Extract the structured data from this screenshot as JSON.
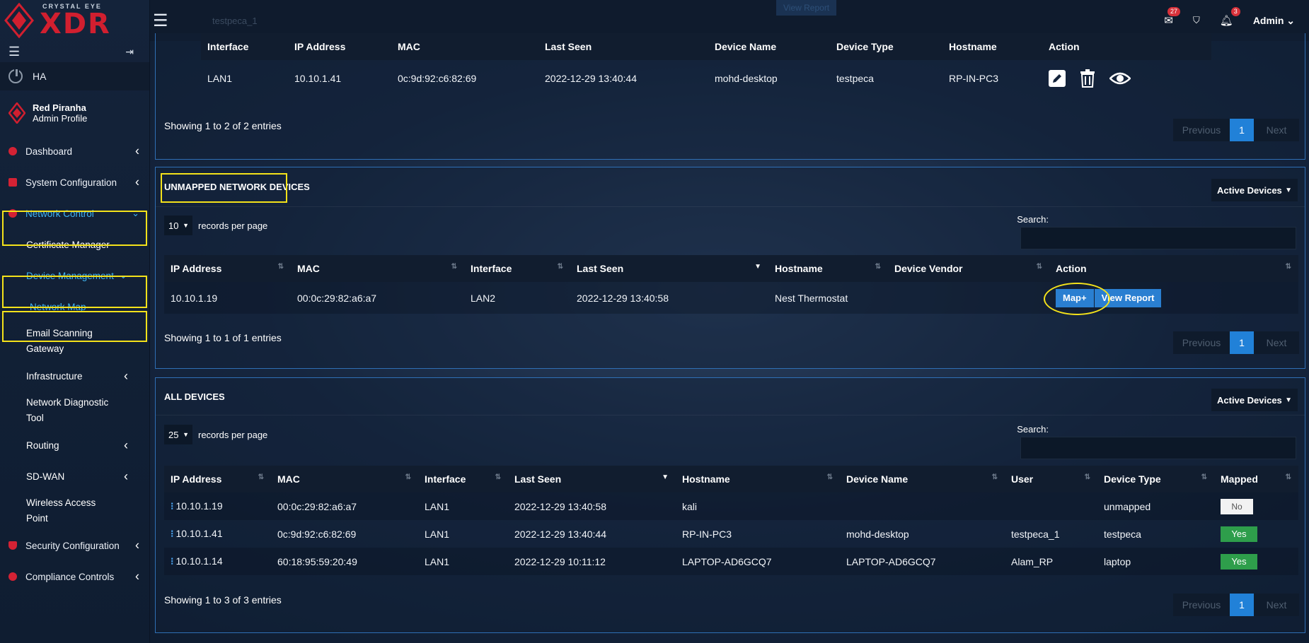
{
  "brand": {
    "small": "CRYSTAL EYE",
    "big": "XDR"
  },
  "header": {
    "tab_hint": "testpeca_1",
    "faded_button": "View Report",
    "admin_label": "Admin",
    "mail_count": "27",
    "bell_count": "3"
  },
  "sidebar": {
    "ha_label": "HA",
    "profile_name": "Red Piranha",
    "profile_role": "Admin Profile",
    "items": {
      "dashboard": "Dashboard",
      "system_configuration": "System Configuration",
      "network_control": "Network Control",
      "certificate_manager": "Certificate Manager",
      "device_management": "Device Management",
      "network_map": "Network Map",
      "email_scanning_1": "Email Scanning",
      "email_scanning_2": "Gateway",
      "infrastructure": "Infrastructure",
      "network_diag_1": "Network Diagnostic",
      "network_diag_2": "Tool",
      "routing": "Routing",
      "sdwan": "SD-WAN",
      "wireless_1": "Wireless Access",
      "wireless_2": "Point",
      "security_configuration": "Security Configuration",
      "compliance_controls": "Compliance Controls"
    }
  },
  "mapped": {
    "headers": [
      "Interface",
      "IP Address",
      "MAC",
      "Last Seen",
      "Device Name",
      "Device Type",
      "Hostname",
      "Action"
    ],
    "row": [
      "LAN1",
      "10.10.1.41",
      "0c:9d:92:c6:82:69",
      "2022-12-29 13:40:44",
      "mohd-desktop",
      "testpeca",
      "RP-IN-PC3"
    ],
    "showing": "Showing 1 to 2 of 2 entries"
  },
  "unmapped": {
    "title": "UNMAPPED NETWORK DEVICES",
    "filter": "Active Devices",
    "rpp_value": "10",
    "rpp_label": "records per page",
    "search_label": "Search:",
    "headers": [
      "IP Address",
      "MAC",
      "Interface",
      "Last Seen",
      "Hostname",
      "Device Vendor",
      "Action"
    ],
    "row": [
      "10.10.1.19",
      "00:0c:29:82:a6:a7",
      "LAN2",
      "2022-12-29 13:40:58",
      "Nest Thermostat",
      ""
    ],
    "map_button": "Map+",
    "report_button": "View Report",
    "showing": "Showing 1 to 1 of 1 entries"
  },
  "all_devices": {
    "title": "ALL DEVICES",
    "filter": "Active Devices",
    "rpp_value": "25",
    "rpp_label": "records per page",
    "search_label": "Search:",
    "headers": [
      "IP Address",
      "MAC",
      "Interface",
      "Last Seen",
      "Hostname",
      "Device Name",
      "User",
      "Device Type",
      "Mapped"
    ],
    "rows": [
      [
        "10.10.1.19",
        "00:0c:29:82:a6:a7",
        "LAN1",
        "2022-12-29 13:40:58",
        "kali",
        "",
        "",
        "unmapped",
        "No"
      ],
      [
        "10.10.1.41",
        "0c:9d:92:c6:82:69",
        "LAN1",
        "2022-12-29 13:40:44",
        "RP-IN-PC3",
        "mohd-desktop",
        "testpeca_1",
        "testpeca",
        "Yes"
      ],
      [
        "10.10.1.14",
        "60:18:95:59:20:49",
        "LAN1",
        "2022-12-29 10:11:12",
        "LAPTOP-AD6GCQ7",
        "LAPTOP-AD6GCQ7",
        "Alam_RP",
        "laptop",
        "Yes"
      ]
    ],
    "showing": "Showing 1 to 3 of 3 entries"
  },
  "pager": {
    "prev": "Previous",
    "page": "1",
    "next": "Next"
  },
  "colors": {
    "accent": "#2181d8",
    "brand_red": "#d11f2f",
    "highlight": "#f4e21a",
    "active_nav": "#3fb3f0",
    "yes_green": "#2e9e4b"
  }
}
